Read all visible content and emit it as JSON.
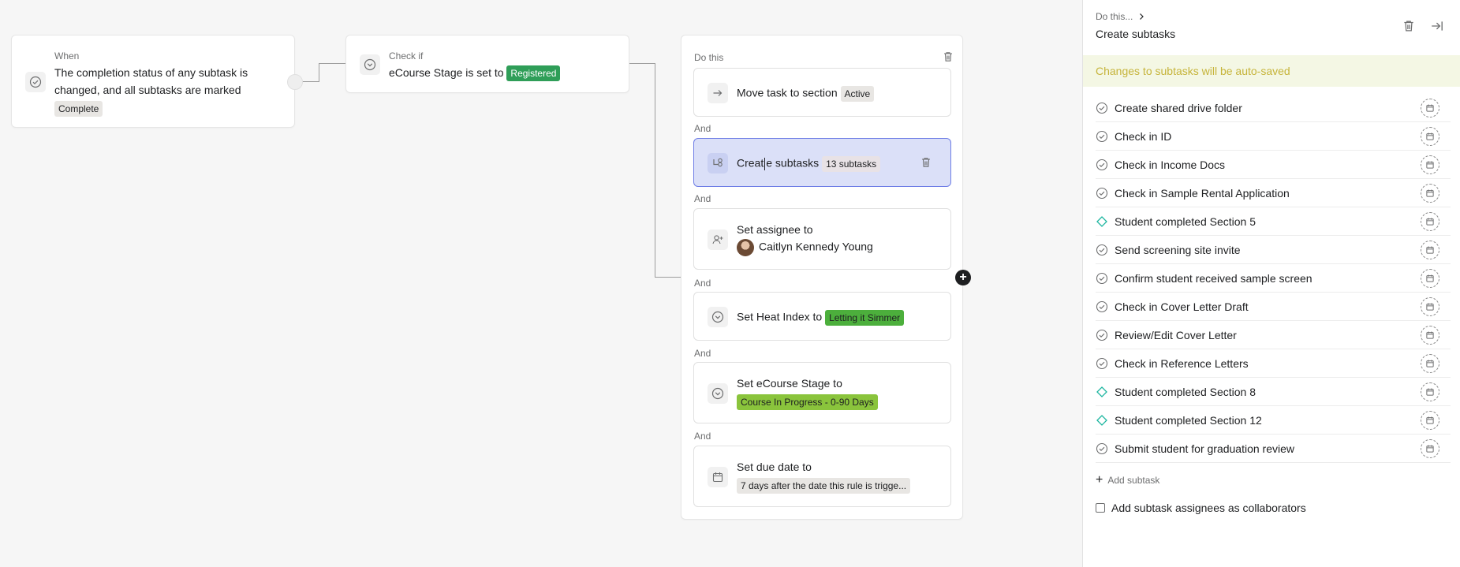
{
  "when": {
    "label": "When",
    "text": "The completion status of any subtask is changed, and all subtasks are marked",
    "chip": "Complete"
  },
  "check": {
    "label": "Check if",
    "text": "eCourse Stage is set to",
    "chip": "Registered"
  },
  "do_panel": {
    "label": "Do this",
    "and_label": "And",
    "actions": [
      {
        "title": "Move task to section",
        "chip": "Active"
      },
      {
        "title_a": "Creat",
        "title_b": "e subtasks",
        "chip": "13 subtasks"
      },
      {
        "title": "Set assignee to",
        "value": "Caitlyn Kennedy Young"
      },
      {
        "title": "Set Heat Index to",
        "chip": "Letting it Simmer"
      },
      {
        "title": "Set eCourse Stage to",
        "chip": "Course In Progress - 0-90 Days"
      },
      {
        "title": "Set due date to",
        "chip": "7 days after the date this rule is trigge..."
      }
    ]
  },
  "sidebar": {
    "breadcrumb": "Do this...",
    "title": "Create subtasks",
    "banner": "Changes to subtasks will be auto-saved",
    "subtasks": [
      {
        "name": "Create shared drive folder",
        "icon": "check-circle-icon"
      },
      {
        "name": "Check in ID",
        "icon": "check-circle-icon"
      },
      {
        "name": "Check in Income Docs",
        "icon": "check-circle-icon"
      },
      {
        "name": "Check in Sample Rental Application",
        "icon": "check-circle-icon"
      },
      {
        "name": "Student completed Section 5",
        "icon": "milestone-diamond-icon"
      },
      {
        "name": "Send screening site invite",
        "icon": "check-circle-icon"
      },
      {
        "name": "Confirm student received sample screen",
        "icon": "check-circle-icon"
      },
      {
        "name": "Check in Cover Letter Draft",
        "icon": "check-circle-icon"
      },
      {
        "name": "Review/Edit Cover Letter",
        "icon": "check-circle-icon"
      },
      {
        "name": "Check in Reference Letters",
        "icon": "check-circle-icon"
      },
      {
        "name": "Student completed Section 8",
        "icon": "milestone-diamond-icon"
      },
      {
        "name": "Student completed Section 12",
        "icon": "milestone-diamond-icon"
      },
      {
        "name": "Submit student for graduation review",
        "icon": "check-circle-icon"
      }
    ],
    "add_subtask": "Add subtask",
    "collaborators": "Add subtask assignees as collaborators"
  },
  "colors": {
    "accent_green": "#2f9e58",
    "lime": "#7cbf3a",
    "selected_bg": "#dbe0f8",
    "milestone": "#1db6a0",
    "banner_text": "#c6b43a"
  }
}
